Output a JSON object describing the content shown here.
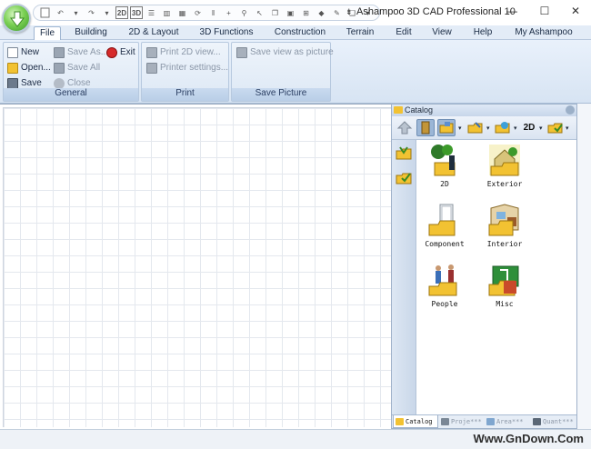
{
  "window": {
    "title": "Ashampoo 3D CAD Professional 10",
    "minimize": "—",
    "maximize": "☐",
    "close": "✕"
  },
  "qat": {
    "label_2d": "2D",
    "label_3d": "3D"
  },
  "menu_tabs": [
    "File",
    "Building",
    "2D & Layout",
    "3D Functions",
    "Construction",
    "Terrain",
    "Edit",
    "View",
    "Help",
    "My Ashampoo"
  ],
  "ribbon": {
    "general": {
      "label": "General",
      "new": "New",
      "open": "Open...",
      "save": "Save",
      "save_as": "Save As...",
      "save_all": "Save All",
      "close": "Close",
      "exit": "Exit"
    },
    "print": {
      "label": "Print",
      "print_2d": "Print 2D view...",
      "printer_settings": "Printer settings..."
    },
    "save_picture": {
      "label": "Save Picture",
      "save_view": "Save view as picture"
    }
  },
  "catalog": {
    "title": "Catalog",
    "toolbar_2d": "2D",
    "items": [
      {
        "label": "2D"
      },
      {
        "label": "Exterior"
      },
      {
        "label": "Component"
      },
      {
        "label": "Interior"
      },
      {
        "label": "People"
      },
      {
        "label": "Misc"
      }
    ],
    "tabs": [
      "Catalog",
      "Proje***",
      "Area***",
      "Quant***"
    ]
  },
  "statusbar": {
    "watermark": "Www.GnDown.Com"
  },
  "colors": {
    "ribbon_bg": "#dde8f5",
    "accent": "#9bb6d6",
    "folder_yellow": "#f2c232"
  }
}
